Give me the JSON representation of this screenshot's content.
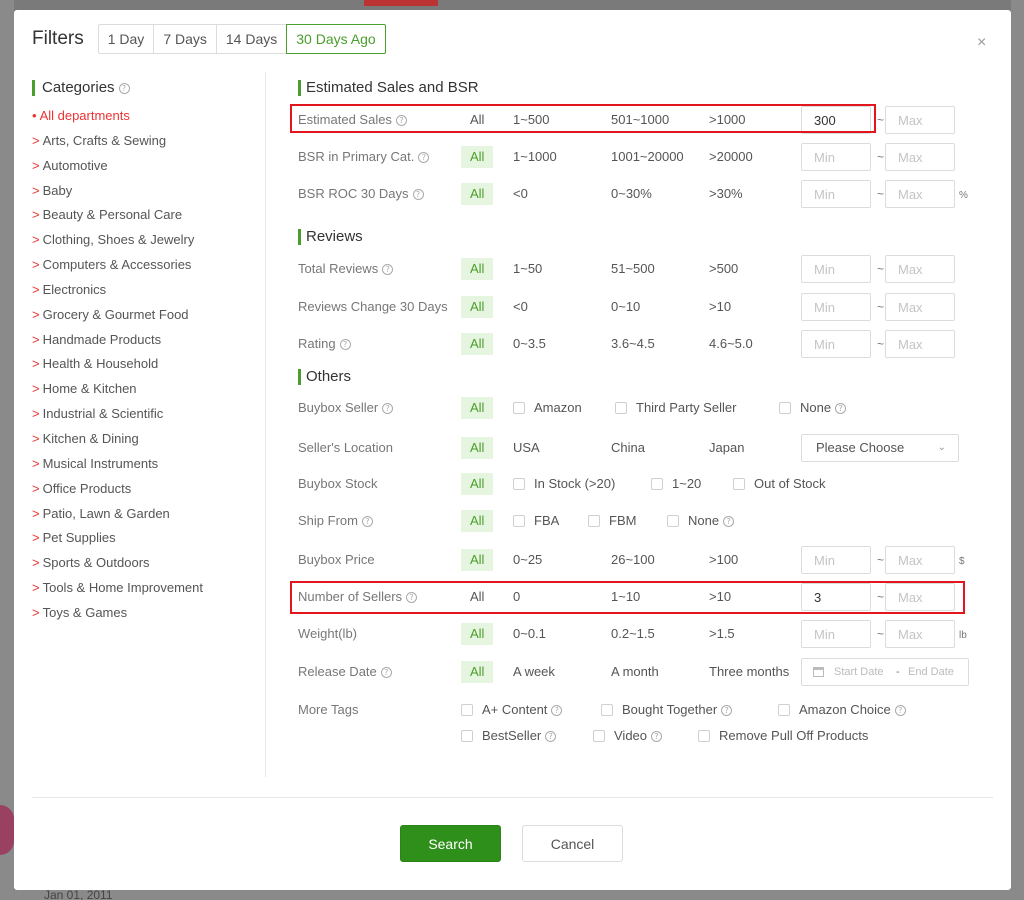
{
  "background": {
    "date_text": "Jan 01, 2011"
  },
  "header": {
    "title": "Filters",
    "ranges": [
      "1 Day",
      "7 Days",
      "14 Days",
      "30 Days Ago"
    ],
    "active_range": "30 Days Ago",
    "close": "×"
  },
  "categories": {
    "title": "Categories",
    "items": [
      "All departments",
      "Arts, Crafts & Sewing",
      "Automotive",
      "Baby",
      "Beauty & Personal Care",
      "Clothing, Shoes & Jewelry",
      "Computers & Accessories",
      "Electronics",
      "Grocery & Gourmet Food",
      "Handmade Products",
      "Health & Household",
      "Home & Kitchen",
      "Industrial & Scientific",
      "Kitchen & Dining",
      "Musical Instruments",
      "Office Products",
      "Patio, Lawn & Garden",
      "Pet Supplies",
      "Sports & Outdoors",
      "Tools & Home Improvement",
      "Toys & Games"
    ]
  },
  "sections": {
    "sales": "Estimated Sales and BSR",
    "reviews": "Reviews",
    "others": "Others"
  },
  "filters": {
    "est_sales": {
      "label": "Estimated Sales",
      "all": "All",
      "o1": "1~500",
      "o2": "501~1000",
      "o3": ">1000",
      "min": "300",
      "max_ph": "Max"
    },
    "bsr": {
      "label": "BSR in Primary Cat.",
      "all": "All",
      "o1": "1~1000",
      "o2": "1001~20000",
      "o3": ">20000",
      "min_ph": "Min",
      "max_ph": "Max"
    },
    "bsr_roc": {
      "label": "BSR ROC 30 Days",
      "all": "All",
      "o1": "<0",
      "o2": "0~30%",
      "o3": ">30%",
      "min_ph": "Min",
      "max_ph": "Max",
      "unit": "%"
    },
    "total_reviews": {
      "label": "Total Reviews",
      "all": "All",
      "o1": "1~50",
      "o2": "51~500",
      "o3": ">500",
      "min_ph": "Min",
      "max_ph": "Max"
    },
    "reviews_change": {
      "label": "Reviews Change 30 Days",
      "all": "All",
      "o1": "<0",
      "o2": "0~10",
      "o3": ">10",
      "min_ph": "Min",
      "max_ph": "Max"
    },
    "rating": {
      "label": "Rating",
      "all": "All",
      "o1": "0~3.5",
      "o2": "3.6~4.5",
      "o3": "4.6~5.0",
      "min_ph": "Min",
      "max_ph": "Max"
    },
    "buybox_seller": {
      "label": "Buybox Seller",
      "all": "All",
      "c1": "Amazon",
      "c2": "Third Party Seller",
      "c3": "None"
    },
    "seller_location": {
      "label": "Seller's Location",
      "all": "All",
      "o1": "USA",
      "o2": "China",
      "o3": "Japan",
      "select": "Please Choose"
    },
    "buybox_stock": {
      "label": "Buybox Stock",
      "all": "All",
      "c1": "In Stock (>20)",
      "c2": "1~20",
      "c3": "Out of Stock"
    },
    "ship_from": {
      "label": "Ship From",
      "all": "All",
      "c1": "FBA",
      "c2": "FBM",
      "c3": "None"
    },
    "buybox_price": {
      "label": "Buybox Price",
      "all": "All",
      "o1": "0~25",
      "o2": "26~100",
      "o3": ">100",
      "min_ph": "Min",
      "max_ph": "Max",
      "unit": "$"
    },
    "num_sellers": {
      "label": "Number of Sellers",
      "all": "All",
      "o1": "0",
      "o2": "1~10",
      "o3": ">10",
      "min": "3",
      "max_ph": "Max"
    },
    "weight": {
      "label": "Weight(lb)",
      "all": "All",
      "o1": "0~0.1",
      "o2": "0.2~1.5",
      "o3": ">1.5",
      "min_ph": "Min",
      "max_ph": "Max",
      "unit": "lb"
    },
    "release_date": {
      "label": "Release Date",
      "all": "All",
      "o1": "A week",
      "o2": "A month",
      "o3": "Three months",
      "start_ph": "Start Date",
      "dash": "-",
      "end_ph": "End Date"
    },
    "more_tags": {
      "label": "More Tags",
      "c1": "A+ Content",
      "c2": "Bought Together",
      "c3": "Amazon Choice",
      "c4": "BestSeller",
      "c5": "Video",
      "c6": "Remove Pull Off Products"
    }
  },
  "tilde": "~",
  "question_glyph": "?",
  "footer": {
    "search": "Search",
    "cancel": "Cancel"
  },
  "colors": {
    "accent": "#4a9e2c",
    "primary_button": "#2f8f1b",
    "highlight": "#e3161d",
    "active_category": "#e33333"
  }
}
